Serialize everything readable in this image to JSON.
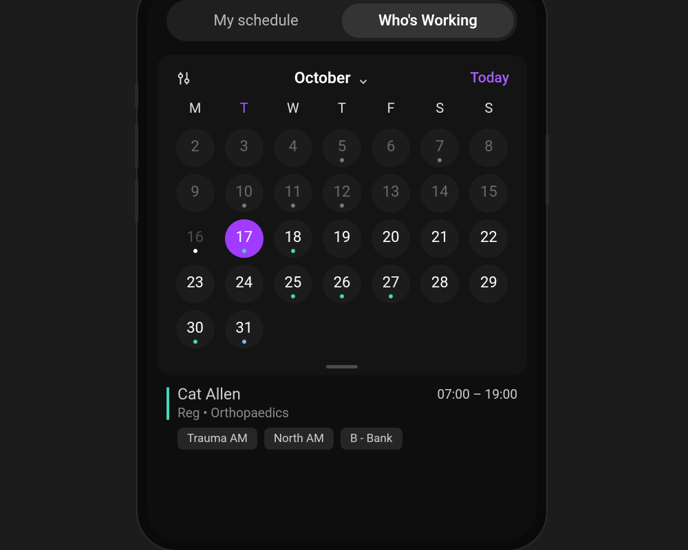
{
  "colors": {
    "accent_purple": "#a03bff",
    "teal": "#46d6b7"
  },
  "tabs": {
    "items": [
      {
        "label": "My schedule",
        "active": false
      },
      {
        "label": "Who's Working",
        "active": true
      }
    ]
  },
  "calendar": {
    "month_label": "October",
    "today_label": "Today",
    "dow": [
      "M",
      "T",
      "W",
      "T",
      "F",
      "S",
      "S"
    ],
    "today_dow_index": 1,
    "days": [
      {
        "n": "2",
        "muted": true
      },
      {
        "n": "3",
        "muted": true
      },
      {
        "n": "4",
        "muted": true
      },
      {
        "n": "5",
        "muted": true,
        "dot": "grey"
      },
      {
        "n": "6",
        "muted": true
      },
      {
        "n": "7",
        "muted": true,
        "dot": "grey"
      },
      {
        "n": "8",
        "muted": true
      },
      {
        "n": "9",
        "muted": true
      },
      {
        "n": "10",
        "muted": true,
        "dot": "grey"
      },
      {
        "n": "11",
        "muted": true,
        "dot": "grey"
      },
      {
        "n": "12",
        "muted": true,
        "dot": "grey"
      },
      {
        "n": "13",
        "muted": true
      },
      {
        "n": "14",
        "muted": true
      },
      {
        "n": "15",
        "muted": true
      },
      {
        "n": "16",
        "ghost": true,
        "dot": "white"
      },
      {
        "n": "17",
        "selected": true,
        "dot": "teal"
      },
      {
        "n": "18",
        "dot": "teal"
      },
      {
        "n": "19"
      },
      {
        "n": "20"
      },
      {
        "n": "21"
      },
      {
        "n": "22"
      },
      {
        "n": "23"
      },
      {
        "n": "24"
      },
      {
        "n": "25",
        "dot": "teal"
      },
      {
        "n": "26",
        "dot": "teal"
      },
      {
        "n": "27",
        "dot": "teal"
      },
      {
        "n": "28"
      },
      {
        "n": "29"
      },
      {
        "n": "30",
        "dot": "teal"
      },
      {
        "n": "31",
        "dot": "blue"
      }
    ]
  },
  "shift": {
    "name": "Cat Allen",
    "subtitle": "Reg • Orthopaedics",
    "time": "07:00 – 19:00",
    "chips": [
      "Trauma AM",
      "North AM",
      "B - Bank"
    ]
  }
}
